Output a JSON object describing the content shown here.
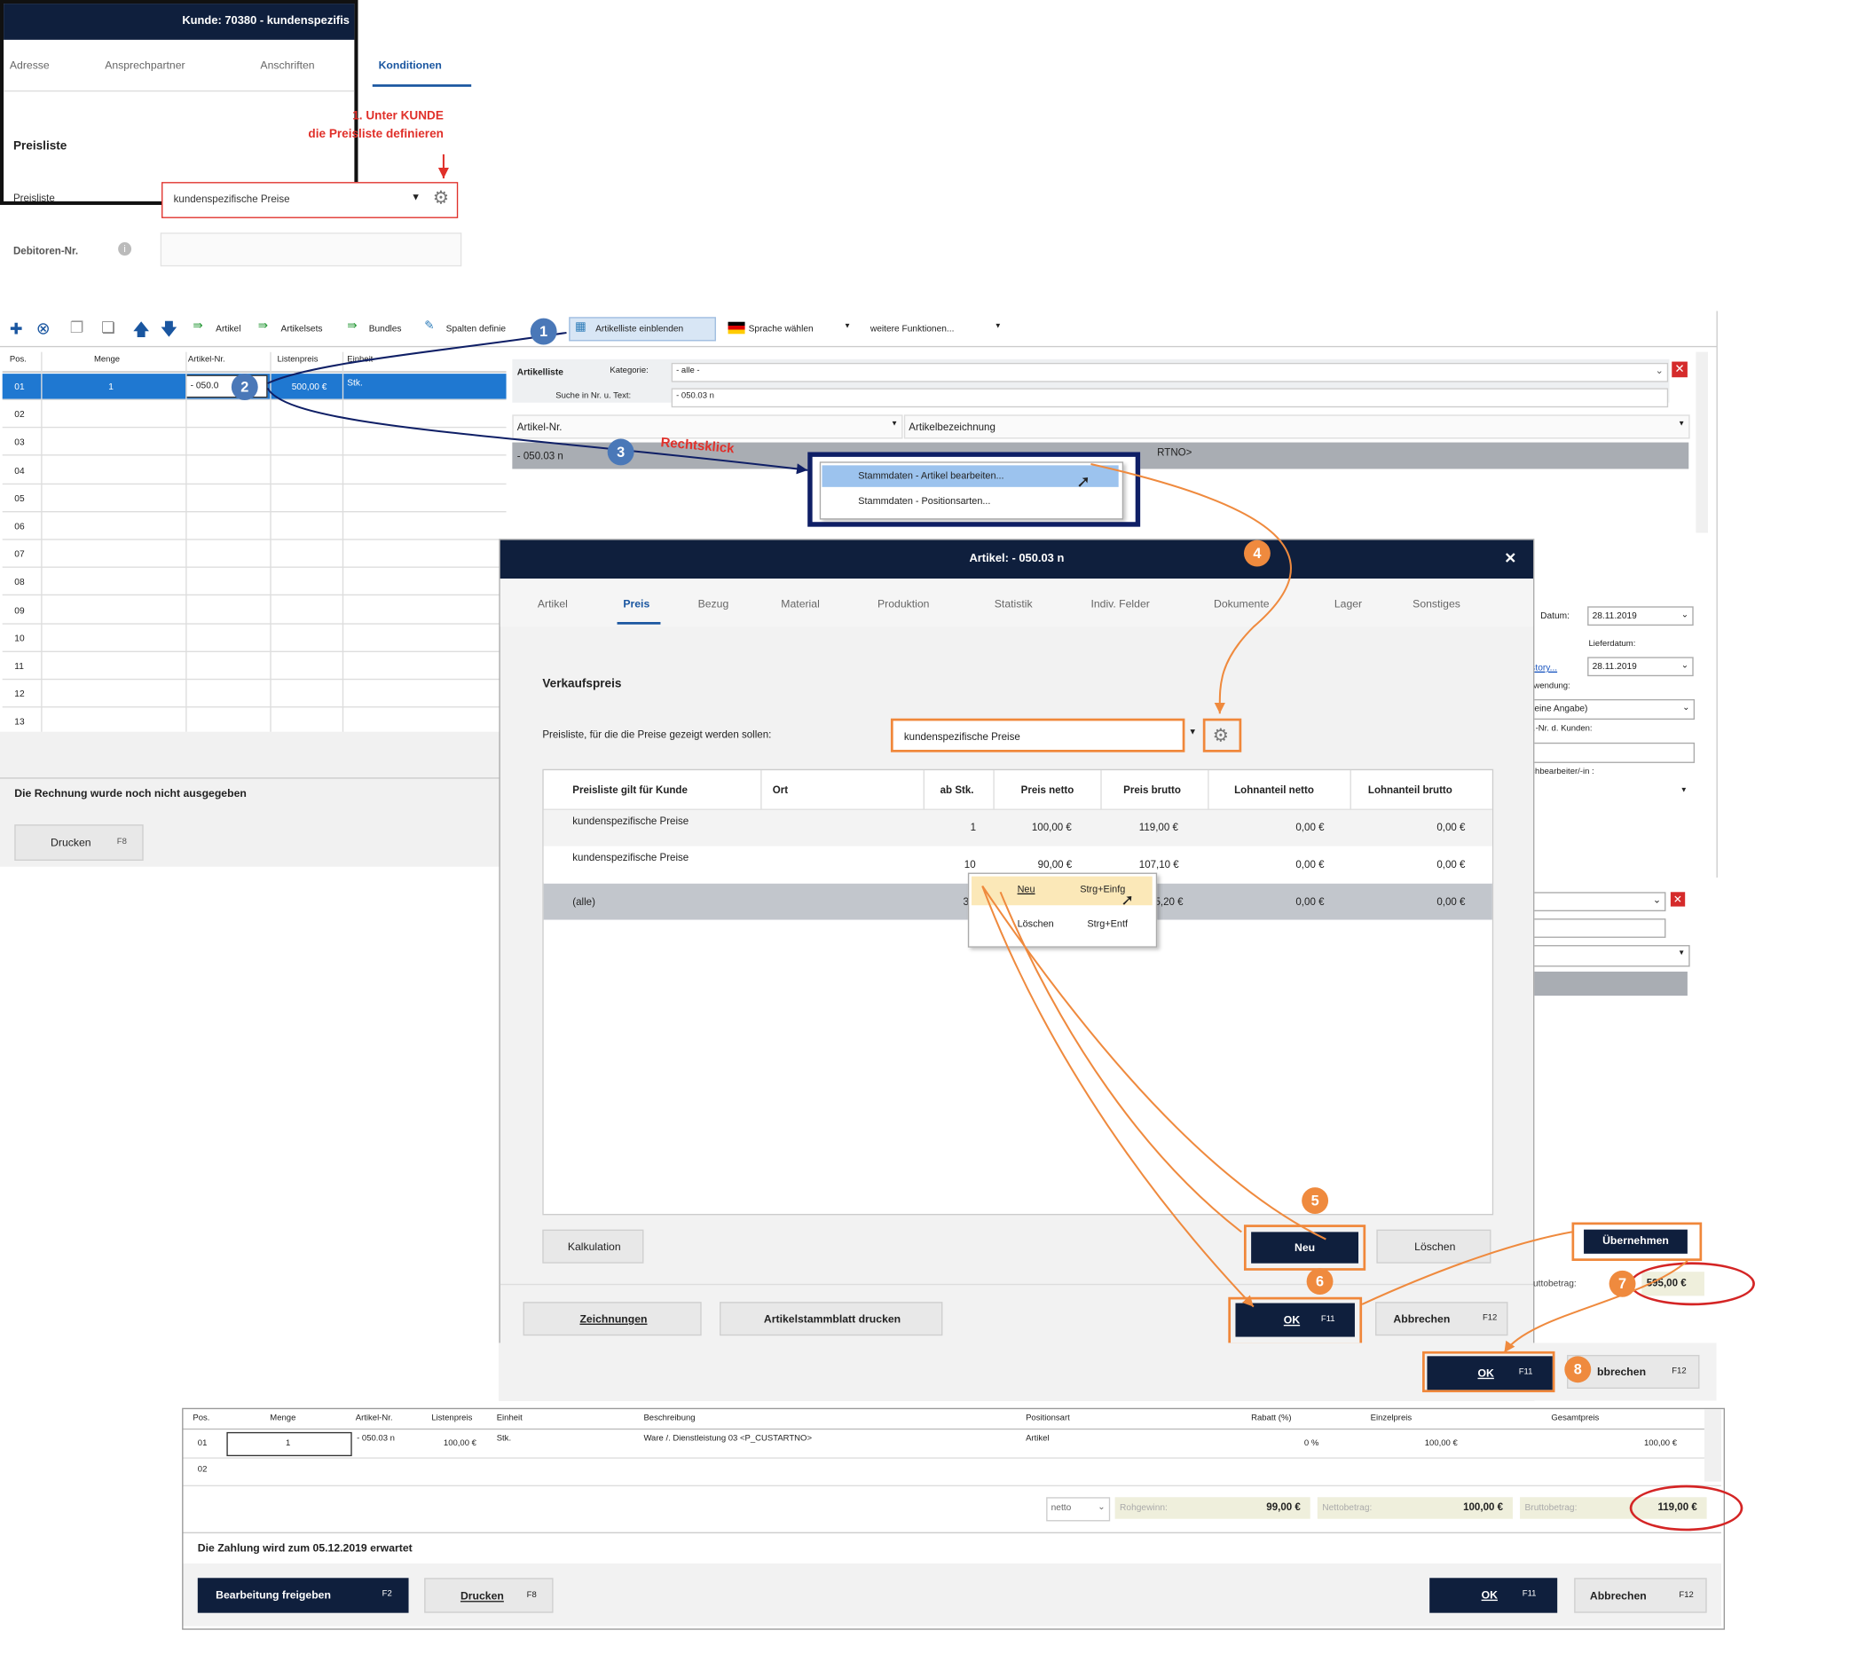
{
  "customer_window": {
    "title": "Kunde: 70380 - kundenspezifis",
    "tabs": [
      "Adresse",
      "Ansprechpartner",
      "Anschriften",
      "Konditionen"
    ],
    "section_title": "Preisliste",
    "annotation_line1": "1. Unter KUNDE",
    "annotation_line2": "die Preisliste definieren",
    "field_label": "Preisliste",
    "field_value": "kundenspezifische Preise",
    "debitor_label": "Debitoren-Nr."
  },
  "toolbar": {
    "artikel": "Artikel",
    "artikelsets": "Artikelsets",
    "bundles": "Bundles",
    "spalten": "Spalten definie",
    "artikelliste": "Artikelliste einblenden",
    "sprache": "Sprache wählen",
    "weitere": "weitere Funktionen..."
  },
  "positions_grid": {
    "headers": [
      "Pos.",
      "Menge",
      "Artikel-Nr.",
      "Listenpreis",
      "Einheit"
    ],
    "rows": [
      "01",
      "02",
      "03",
      "04",
      "05",
      "06",
      "07",
      "08",
      "09",
      "10",
      "11",
      "12",
      "13"
    ],
    "row1_menge": "1",
    "row1_artnr": "- 050.0",
    "row1_price": "500,00 €",
    "row1_unit": "Stk."
  },
  "invoice_status": "Die Rechnung wurde noch nicht ausgegeben",
  "print_button": {
    "label": "Drucken",
    "key": "F8"
  },
  "artikelliste": {
    "title": "Artikelliste",
    "kategorie_label": "Kategorie:",
    "kategorie_value": "- alle -",
    "suche_label": "Suche in Nr. u. Text:",
    "suche_value": "- 050.03 n",
    "col1": "Artikel-Nr.",
    "col2": "Artikelbezeichnung",
    "row_nr": "- 050.03 n",
    "row_text": "RTNO>"
  },
  "rechtsklick": "Rechtsklick",
  "context_menu1": [
    "Stammdaten - Artikel bearbeiten...",
    "Stammdaten - Positionsarten..."
  ],
  "right_panel": {
    "datum_label": "Datum:",
    "datum_value": "28.11.2019",
    "lieferdatum_label": "Lieferdatum:",
    "lieferdatum_value": "28.11.2019",
    "history_link": "story...",
    "verwendung_label": "rwendung:",
    "verwendung_value": "eine Angabe)",
    "ref_label": "f.-Nr. d. Kunden:",
    "bearbeiter_label": "chbearbeiter/-in :",
    "uebernehmen": "Übernehmen",
    "brutto_label": "uttobetrag:",
    "brutto_value": "595,00 €",
    "ok_label": "OK",
    "ok_key": "F11",
    "abbrechen_label": "bbrechen",
    "abbrechen_key": "F12"
  },
  "article_dialog": {
    "title": "Artikel: - 050.03 n",
    "tabs": [
      "Artikel",
      "Preis",
      "Bezug",
      "Material",
      "Produktion",
      "Statistik",
      "Indiv. Felder",
      "Dokumente",
      "Lager",
      "Sonstiges"
    ],
    "section": "Verkaufspreis",
    "pricelist_label": "Preisliste, für die die Preise gezeigt werden sollen:",
    "pricelist_value": "kundenspezifische Preise",
    "table_headers": [
      "Preisliste gilt für Kunde",
      "Ort",
      "ab Stk.",
      "Preis netto",
      "Preis brutto",
      "Lohnanteil netto",
      "Lohnanteil brutto"
    ],
    "rows": [
      [
        "kundenspezifische Preise",
        "",
        "1",
        "100,00 €",
        "119,00 €",
        "0,00 €",
        "0,00 €"
      ],
      [
        "kundenspezifische Preise",
        "",
        "10",
        "90,00 €",
        "107,10 €",
        "0,00 €",
        "0,00 €"
      ],
      [
        "(alle)",
        "",
        "3",
        "",
        "5,20 €",
        "0,00 €",
        "0,00 €"
      ]
    ],
    "context_menu": [
      {
        "label": "Neu",
        "shortcut": "Strg+Einfg"
      },
      {
        "label": "Löschen",
        "shortcut": "Strg+Entf"
      }
    ],
    "kalkulation": "Kalkulation",
    "neu": "Neu",
    "loeschen": "Löschen",
    "zeichnungen": "Zeichnungen",
    "stammblatt": "Artikelstammblatt drucken",
    "ok_label": "OK",
    "ok_key": "F11",
    "abbrechen_label": "Abbrechen",
    "abbrechen_key": "F12"
  },
  "badges": [
    "1",
    "2",
    "3",
    "4",
    "5",
    "6",
    "7",
    "8"
  ],
  "bottom_invoice": {
    "headers": [
      "Pos.",
      "Menge",
      "Artikel-Nr.",
      "Listenpreis",
      "Einheit",
      "Beschreibung",
      "Positionsart",
      "Rabatt (%)",
      "Einzelpreis",
      "Gesamtpreis"
    ],
    "row1": [
      "01",
      "1",
      "- 050.03 n",
      "100,00 €",
      "Stk.",
      "Ware /. Dienstleistung 03 <P_CUSTARTNO>",
      "Artikel",
      "0 %",
      "100,00 €",
      "100,00 €"
    ],
    "row2_pos": "02",
    "netto_select": "netto",
    "rohgewinn_label": "Rohgewinn:",
    "rohgewinn_value": "99,00 €",
    "nettobetrag_label": "Nettobetrag:",
    "nettobetrag_value": "100,00 €",
    "bruttobetrag_label": "Bruttobetrag:",
    "bruttobetrag_value": "119,00 €",
    "status": "Die Zahlung wird zum 05.12.2019 erwartet",
    "freigeben_label": "Bearbeitung freigeben",
    "freigeben_key": "F2",
    "drucken_label": "Drucken",
    "drucken_key": "F8",
    "ok_label": "OK",
    "ok_key": "F11",
    "abbrechen_label": "Abbrechen",
    "abbrechen_key": "F12"
  },
  "colors": {
    "navy": "#0f1f3d",
    "orange": "#ef8a3e",
    "red": "#e0302a",
    "blue_badge": "#4a78b8",
    "selection": "#1f78d1"
  }
}
